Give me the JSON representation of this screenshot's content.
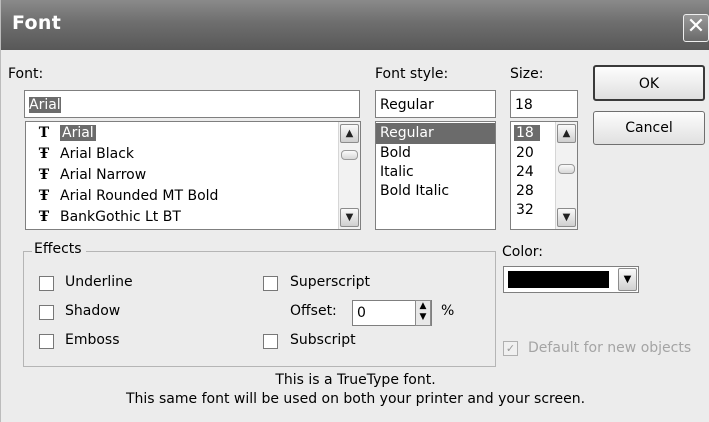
{
  "window": {
    "title": "Font",
    "close_glyph": "✕"
  },
  "font": {
    "label": "Font:",
    "value": "Arial",
    "items": [
      "Arial",
      "Arial Black",
      "Arial Narrow",
      "Arial Rounded MT Bold",
      "BankGothic Lt BT"
    ],
    "selected_index": 0,
    "item_icon": "truetype-icon"
  },
  "style": {
    "label": "Font style:",
    "value": "Regular",
    "items": [
      "Regular",
      "Bold",
      "Italic",
      "Bold Italic"
    ],
    "selected_index": 0
  },
  "size": {
    "label": "Size:",
    "value": "18",
    "items": [
      "18",
      "20",
      "24",
      "28",
      "32"
    ],
    "selected_index": 0
  },
  "buttons": {
    "ok": "OK",
    "cancel": "Cancel"
  },
  "effects": {
    "legend": "Effects",
    "underline": "Underline",
    "shadow": "Shadow",
    "emboss": "Emboss",
    "superscript": "Superscript",
    "subscript": "Subscript",
    "offset_label": "Offset:",
    "offset_value": "0",
    "offset_unit": "%"
  },
  "color": {
    "label": "Color:",
    "value": "#000000"
  },
  "default_for_new": "Default for new objects",
  "description": {
    "line1": "This is a TrueType font.",
    "line2": "This same font will be used on both your printer and your screen."
  }
}
